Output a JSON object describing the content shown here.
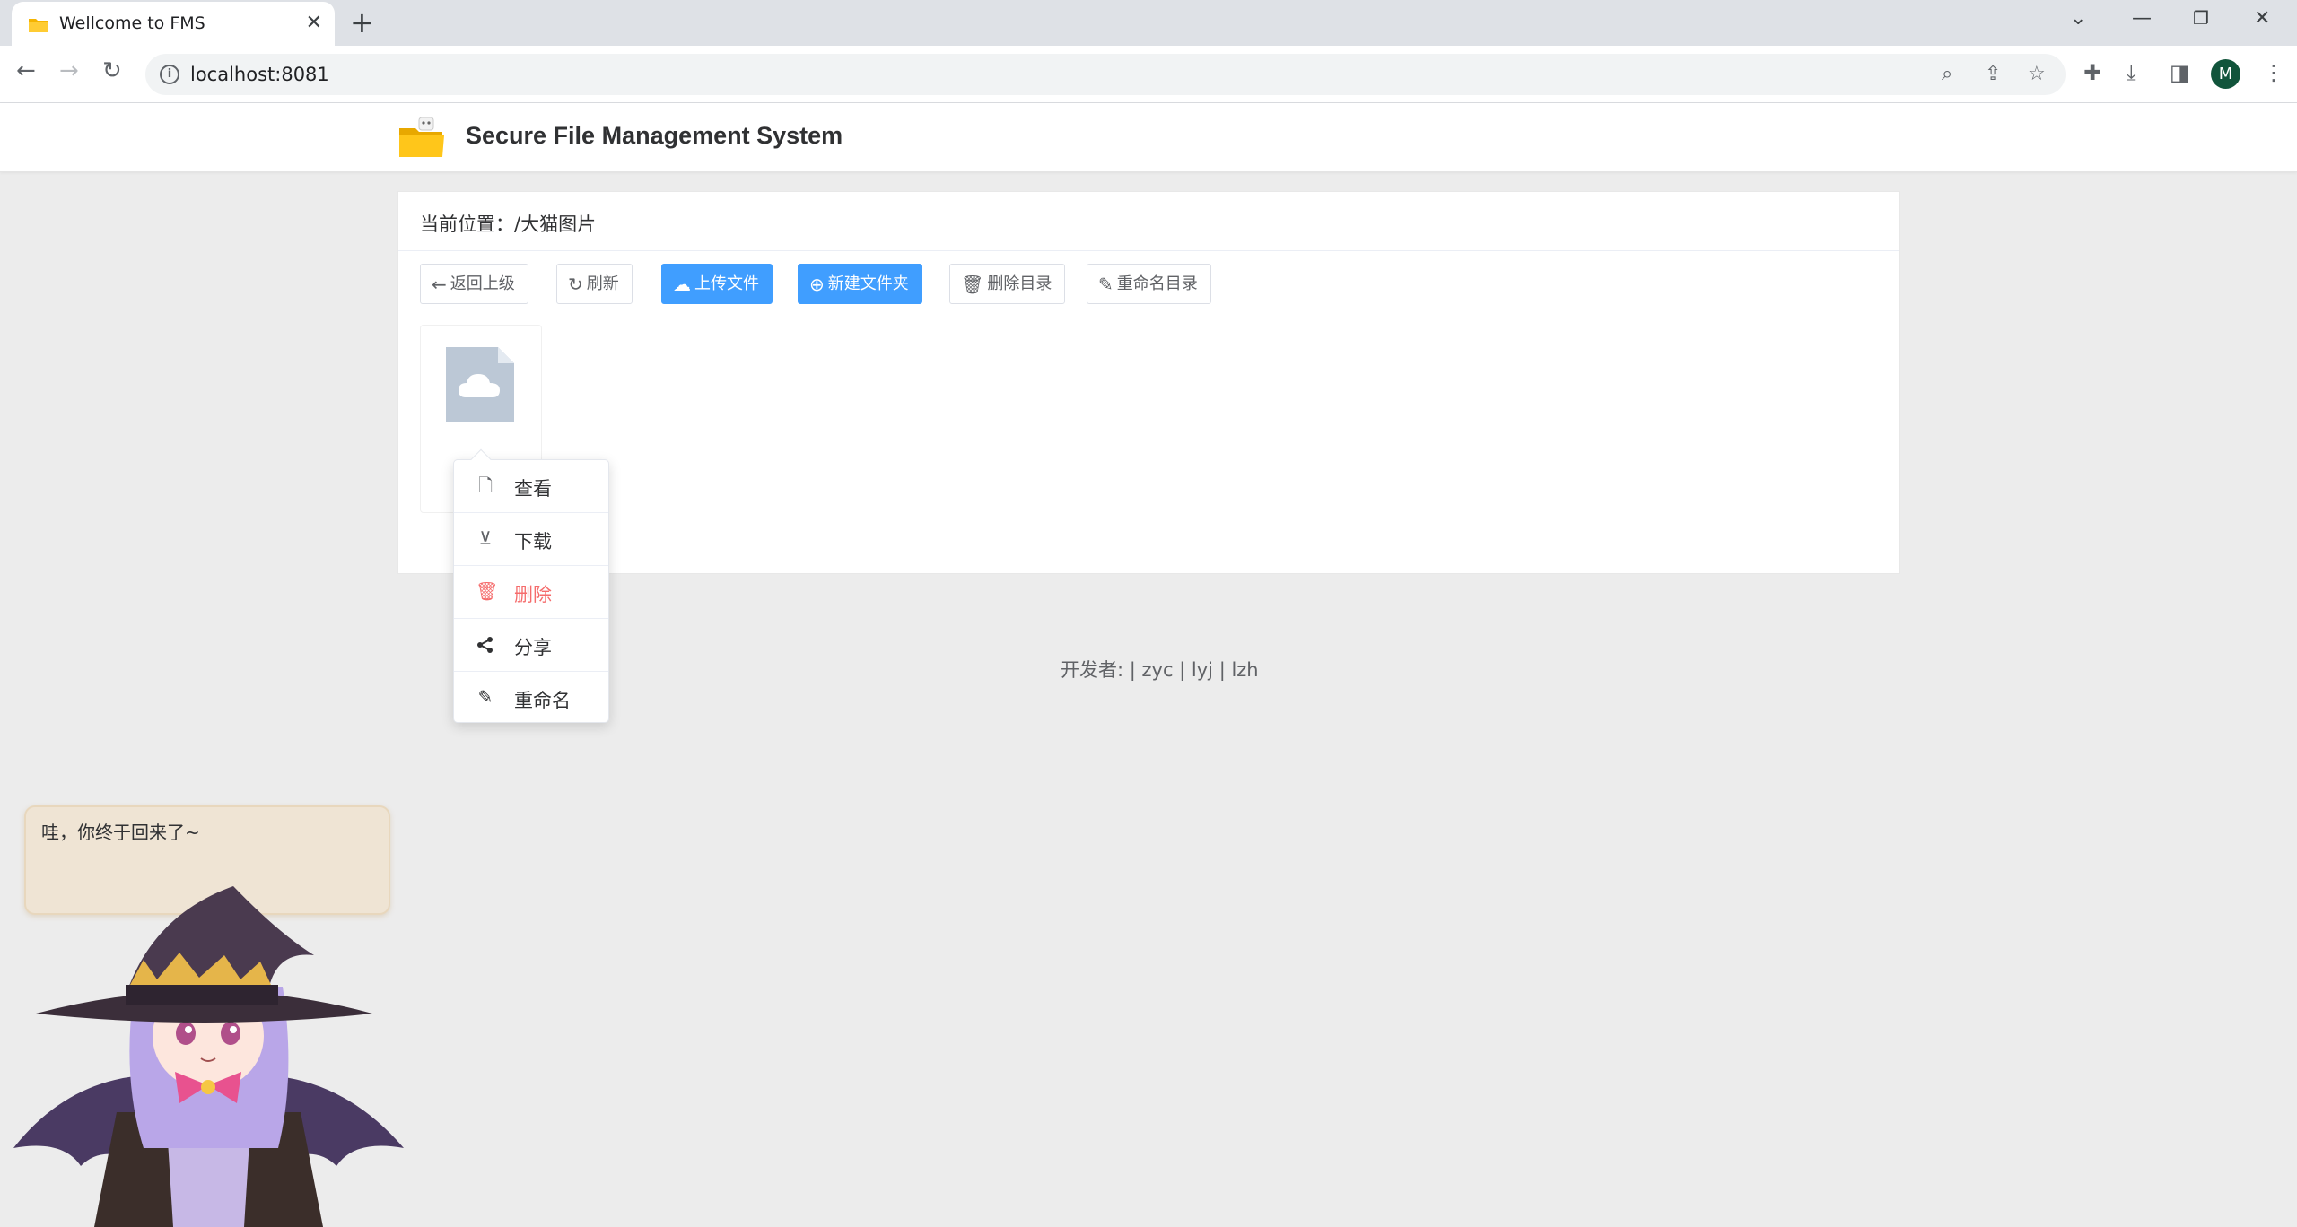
{
  "browser": {
    "tab_title": "Wellcome to FMS",
    "url": "localhost:8081",
    "profile_initial": "M"
  },
  "app": {
    "name": "Secure File Management System"
  },
  "breadcrumb": {
    "label": "当前位置：",
    "path": "/大猫图片"
  },
  "toolbar": {
    "back": "返回上级",
    "refresh": "刷新",
    "upload": "上传文件",
    "new_folder": "新建文件夹",
    "delete_dir": "删除目录",
    "rename_dir": "重命名目录"
  },
  "files": [
    {
      "name": "",
      "icon": "cloud-file-icon"
    }
  ],
  "context_menu": {
    "view": "查看",
    "download": "下载",
    "delete": "删除",
    "share": "分享",
    "rename": "重命名"
  },
  "footer": {
    "text": "开发者: | zyc | lyj | lzh"
  },
  "mascot": {
    "bubble_text": "哇，你终于回来了~"
  },
  "colors": {
    "primary": "#409eff",
    "danger": "#f56c6c",
    "page_bg": "#ececec"
  }
}
